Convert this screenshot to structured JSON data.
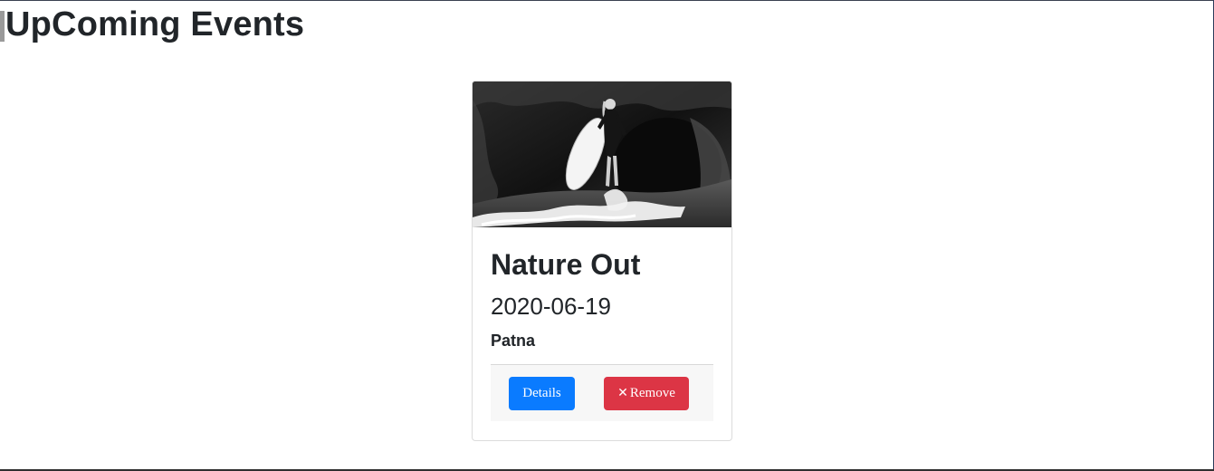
{
  "page": {
    "title": "UpComing Events"
  },
  "event": {
    "image_alt": "Surfer holding surfboard on beach",
    "title": "Nature Out",
    "date": "2020-06-19",
    "place": "Patna",
    "details_label": "Details",
    "remove_label": "Remove",
    "remove_icon": "close-icon"
  },
  "colors": {
    "details_button": "#0a7bff",
    "remove_button": "#dc3545",
    "footer_bg": "#f7f7f7"
  }
}
